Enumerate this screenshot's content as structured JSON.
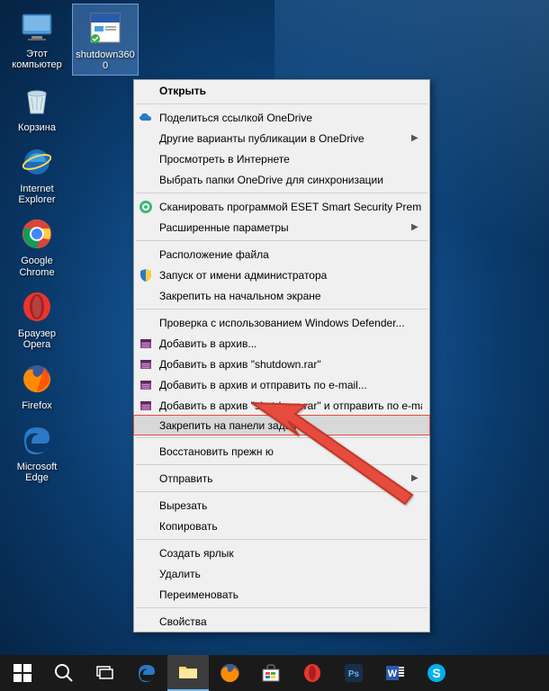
{
  "desktop": {
    "icons": [
      {
        "name": "this-pc",
        "label": "Этот\nкомпьютер"
      },
      {
        "name": "shutdown-shortcut",
        "label": "shutdown3600",
        "selected": true
      },
      {
        "name": "recycle-bin",
        "label": "Корзина"
      },
      {
        "name": "internet-explorer",
        "label": "Internet\nExplorer"
      },
      {
        "name": "google-chrome",
        "label": "Google\nChrome"
      },
      {
        "name": "opera",
        "label": "Браузер\nOpera"
      },
      {
        "name": "firefox",
        "label": "Firefox"
      },
      {
        "name": "microsoft-edge",
        "label": "Microsoft\nEdge"
      }
    ]
  },
  "context_menu": {
    "items": [
      {
        "label": "Открыть",
        "bold": true
      },
      {
        "sep": true
      },
      {
        "label": "Поделиться ссылкой OneDrive",
        "icon": "onedrive"
      },
      {
        "label": "Другие варианты публикации в OneDrive",
        "submenu": true
      },
      {
        "label": "Просмотреть в Интернете"
      },
      {
        "label": "Выбрать папки OneDrive для синхронизации"
      },
      {
        "sep": true
      },
      {
        "label": "Сканировать программой ESET Smart Security Premium",
        "icon": "eset"
      },
      {
        "label": "Расширенные параметры",
        "submenu": true
      },
      {
        "sep": true
      },
      {
        "label": "Расположение файла"
      },
      {
        "label": "Запуск от имени администратора",
        "icon": "shield"
      },
      {
        "label": "Закрепить на начальном экране"
      },
      {
        "sep": true
      },
      {
        "label": "Проверка с использованием Windows Defender..."
      },
      {
        "label": "Добавить в архив...",
        "icon": "winrar"
      },
      {
        "label": "Добавить в архив \"shutdown.rar\"",
        "icon": "winrar"
      },
      {
        "label": "Добавить в архив и отправить по e-mail...",
        "icon": "winrar"
      },
      {
        "label": "Добавить в архив \"shutdown.rar\" и отправить по e-mail",
        "icon": "winrar"
      },
      {
        "label": "Закрепить на панели задач",
        "highlighted": true
      },
      {
        "sep": true
      },
      {
        "label": "Восстановить прежн               ю"
      },
      {
        "sep": true
      },
      {
        "label": "Отправить",
        "submenu": true
      },
      {
        "sep": true
      },
      {
        "label": "Вырезать"
      },
      {
        "label": "Копировать"
      },
      {
        "sep": true
      },
      {
        "label": "Создать ярлык"
      },
      {
        "label": "Удалить"
      },
      {
        "label": "Переименовать"
      },
      {
        "sep": true
      },
      {
        "label": "Свойства"
      }
    ]
  },
  "taskbar": {
    "items": [
      {
        "name": "start",
        "active": false
      },
      {
        "name": "search",
        "active": false
      },
      {
        "name": "task-view",
        "active": false
      },
      {
        "name": "edge",
        "active": false
      },
      {
        "name": "file-explorer",
        "active": true
      },
      {
        "name": "firefox",
        "active": false
      },
      {
        "name": "store",
        "active": false
      },
      {
        "name": "opera",
        "active": false
      },
      {
        "name": "photoshop",
        "active": false
      },
      {
        "name": "word",
        "active": false
      },
      {
        "name": "skype",
        "active": false
      }
    ]
  }
}
